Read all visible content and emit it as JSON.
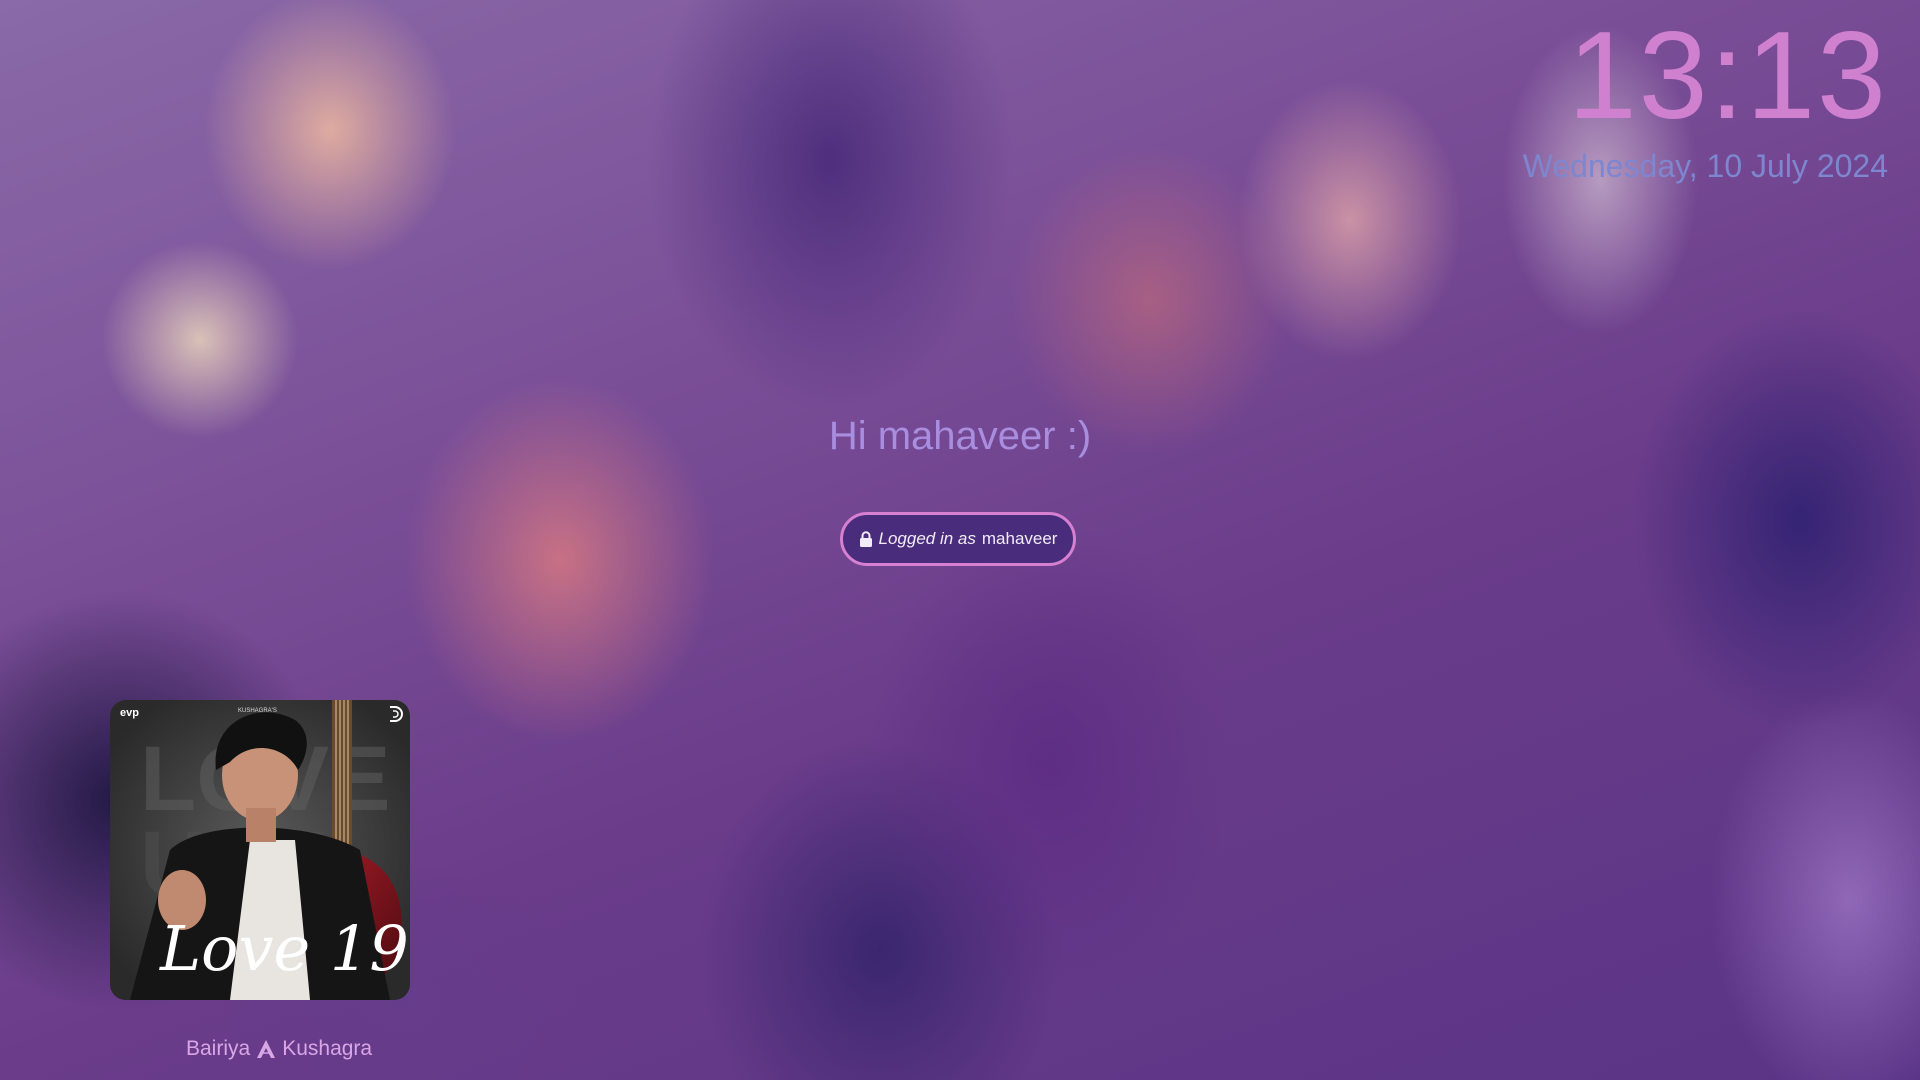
{
  "clock": {
    "time": "13:13",
    "date": "Wednesday, 10 July 2024"
  },
  "greeting": {
    "text": "Hi mahaveer :)"
  },
  "session": {
    "prefix": "Logged in as",
    "user": "mahaveer",
    "icon": "lock-icon"
  },
  "media": {
    "album": {
      "title": "Love 19",
      "brand_top": "KUSHAGRA'S",
      "label_left": "evp",
      "icon": "album-cover"
    },
    "artist_first": "Bairiya",
    "artist_second": "Kushagra",
    "separator_icon": "arch-icon"
  },
  "colors": {
    "clock": "#cf80cf",
    "date": "#7d86cf",
    "greeting": "#a98ee0",
    "pill_border": "#d77fd0",
    "pill_bg": "#4a2c7c",
    "artist": "#d9a6e6"
  }
}
